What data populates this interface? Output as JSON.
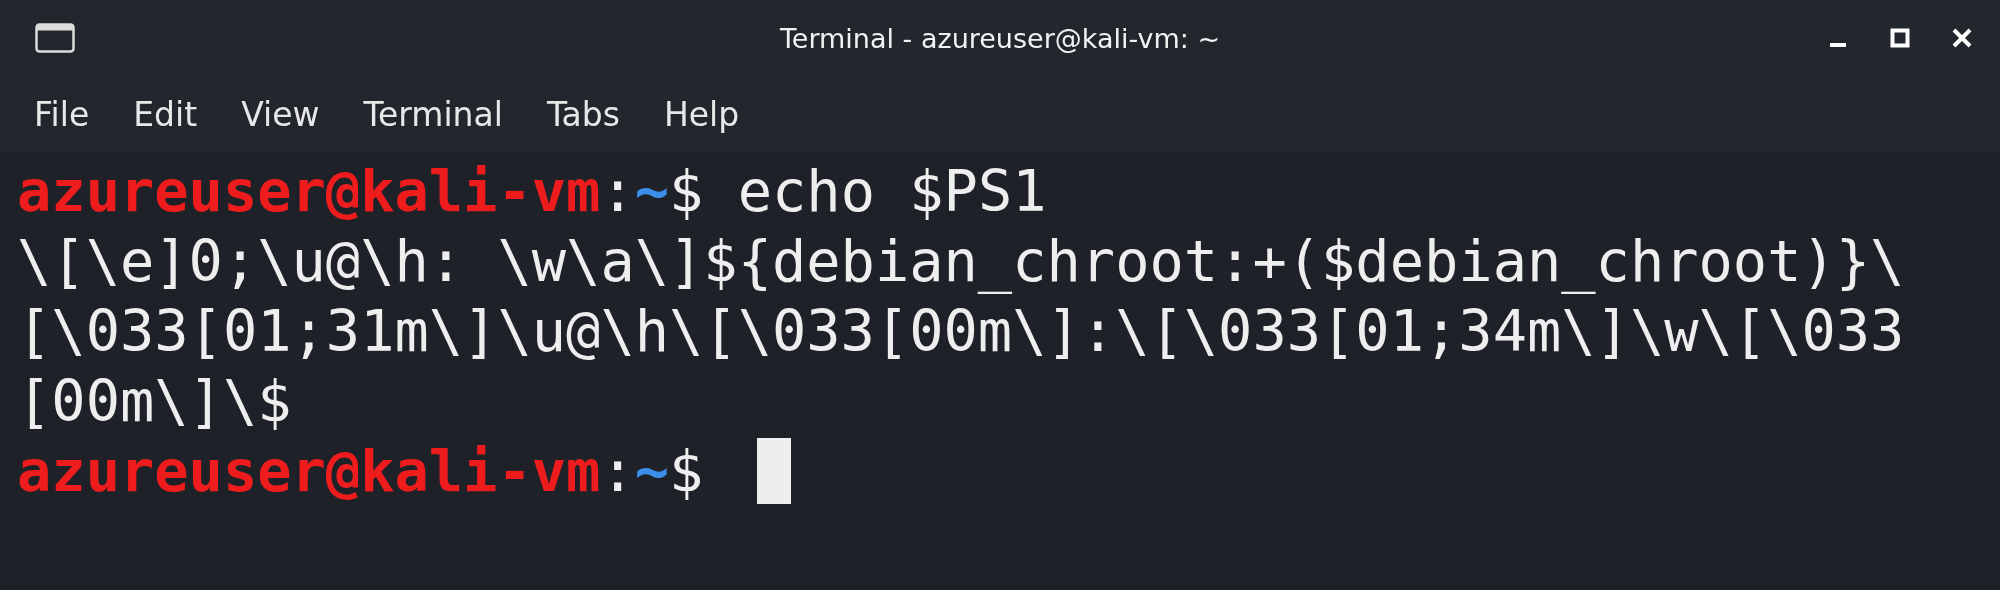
{
  "window": {
    "title": "Terminal - azureuser@kali-vm: ~"
  },
  "menu": [
    "File",
    "Edit",
    "View",
    "Terminal",
    "Tabs",
    "Help"
  ],
  "terminal": {
    "lines": [
      {
        "kind": "prompt",
        "segments": [
          {
            "kind": "user",
            "text": "azureuser@kali-vm"
          },
          {
            "kind": "sep",
            "text": ":"
          },
          {
            "kind": "path",
            "text": "~"
          },
          {
            "kind": "plain",
            "text": "$ echo $PS1"
          }
        ]
      },
      {
        "kind": "output",
        "text": "\\[\\e]0;\\u@\\h: \\w\\a\\]${debian_chroot:+($debian_chroot)}\\"
      },
      {
        "kind": "output",
        "text": "[\\033[01;31m\\]\\u@\\h\\[\\033[00m\\]:\\[\\033[01;34m\\]\\w\\[\\033"
      },
      {
        "kind": "output",
        "text": "[00m\\]\\$"
      },
      {
        "kind": "prompt",
        "cursor": true,
        "segments": [
          {
            "kind": "user",
            "text": "azureuser@kali-vm"
          },
          {
            "kind": "sep",
            "text": ":"
          },
          {
            "kind": "path",
            "text": "~"
          },
          {
            "kind": "plain",
            "text": "$"
          }
        ]
      }
    ]
  }
}
